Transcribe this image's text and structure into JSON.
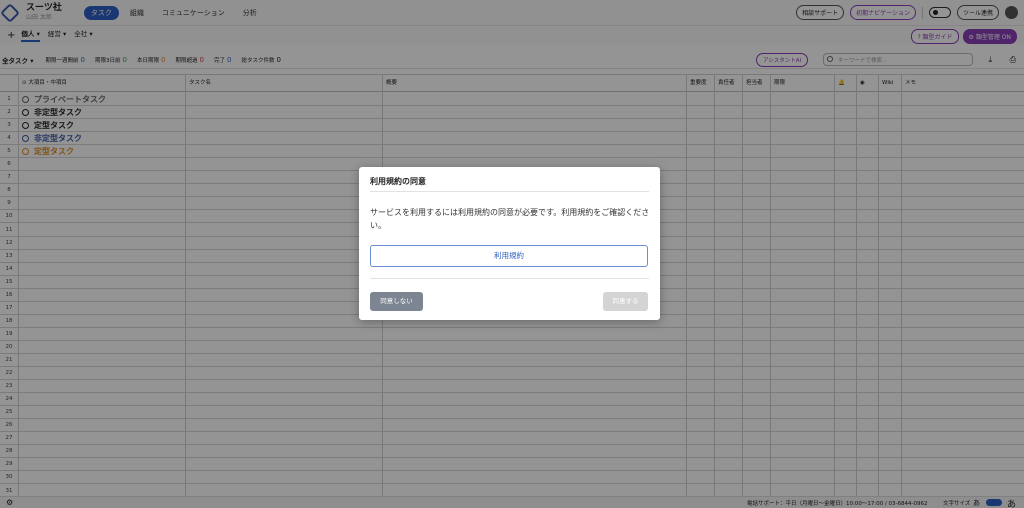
{
  "header": {
    "company": "スーツ社",
    "user": "山田 太郎",
    "tabs": [
      "タスク",
      "組織",
      "コミュニケーション",
      "分析"
    ],
    "support": "相談サポート",
    "navigation": "初期ナビゲーション",
    "tools": "ツール連携"
  },
  "subbar": {
    "scopes": [
      "個人",
      "経営",
      "全社"
    ],
    "guide": "類型ガイド",
    "manage": "類型管理",
    "manage_badge": "ON"
  },
  "filterbar": {
    "filter": "全タスク",
    "stats": [
      {
        "label": "期限一週間前",
        "value": "0",
        "color": "blue"
      },
      {
        "label": "期限3日前",
        "value": "0",
        "color": "green"
      },
      {
        "label": "本日期限",
        "value": "0",
        "color": "orange"
      },
      {
        "label": "期限超過",
        "value": "0",
        "color": "red"
      },
      {
        "label": "完了",
        "value": "0",
        "color": "blue"
      },
      {
        "label": "総タスク件数",
        "value": "0",
        "color": "dark"
      }
    ],
    "assistant": "アシスタントAI",
    "search_placeholder": "キーワードで検索..."
  },
  "table": {
    "columns": [
      "大項目・中項目",
      "タスク名",
      "概要",
      "重要度",
      "責任者",
      "担当者",
      "期限",
      "",
      "",
      "Wiki",
      "メモ"
    ],
    "groups": [
      {
        "label": "プライベートタスク",
        "color": "#666666"
      },
      {
        "label": "非定型タスク",
        "color": "#222222"
      },
      {
        "label": "定型タスク",
        "color": "#222222"
      },
      {
        "label": "非定型タスク",
        "color": "#3b5aa8"
      },
      {
        "label": "定型タスク",
        "color": "#e08a1e"
      }
    ],
    "row_numbers": [
      "1",
      "2",
      "3",
      "4",
      "5",
      "6",
      "7",
      "8",
      "9",
      "10",
      "11",
      "12",
      "13",
      "14",
      "15",
      "16",
      "17",
      "18",
      "19",
      "20",
      "21",
      "22",
      "23",
      "24",
      "25",
      "26",
      "27",
      "28",
      "29",
      "30",
      "31"
    ]
  },
  "footer": {
    "phone": "電話サポート：平日（月曜日〜金曜日）10:00〜17:00 / 03-6844-0962",
    "font_size": "文字サイズ",
    "small_a": "あ",
    "large_a": "あ"
  },
  "modal": {
    "title": "利用規約の同意",
    "body": "サービスを利用するには利用規約の同意が必要です。利用規約をご確認ください。",
    "terms_button": "利用規約",
    "decline": "同意しない",
    "agree": "同意する"
  }
}
